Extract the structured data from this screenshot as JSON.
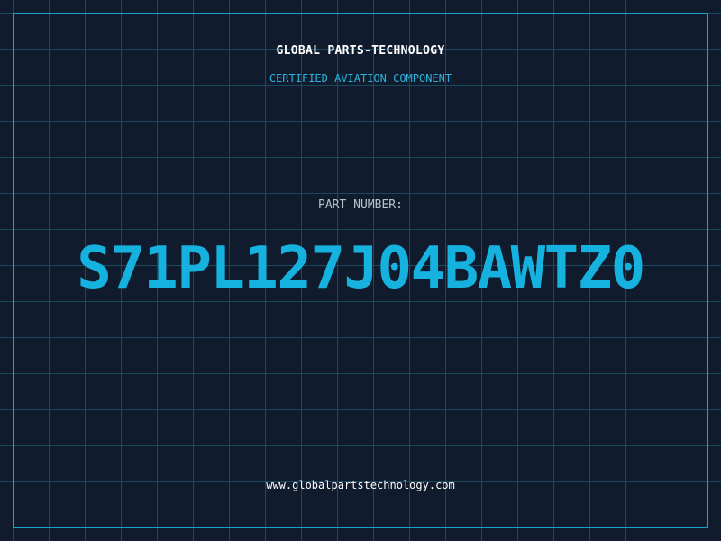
{
  "label": {
    "company_name": "GLOBAL PARTS-TECHNOLOGY",
    "tagline": "CERTIFIED AVIATION COMPONENT",
    "part_number_label": "PART NUMBER:",
    "part_number": "S71PL127J04BAWTZ0",
    "website": "www.globalpartstechnology.com"
  },
  "colors": {
    "background": "#101b2e",
    "grid": "#1b4a5e",
    "border": "#1aa3c8",
    "accent": "#15b2e0",
    "heading_text": "#ffffff",
    "label_text": "#b7c2cc"
  }
}
